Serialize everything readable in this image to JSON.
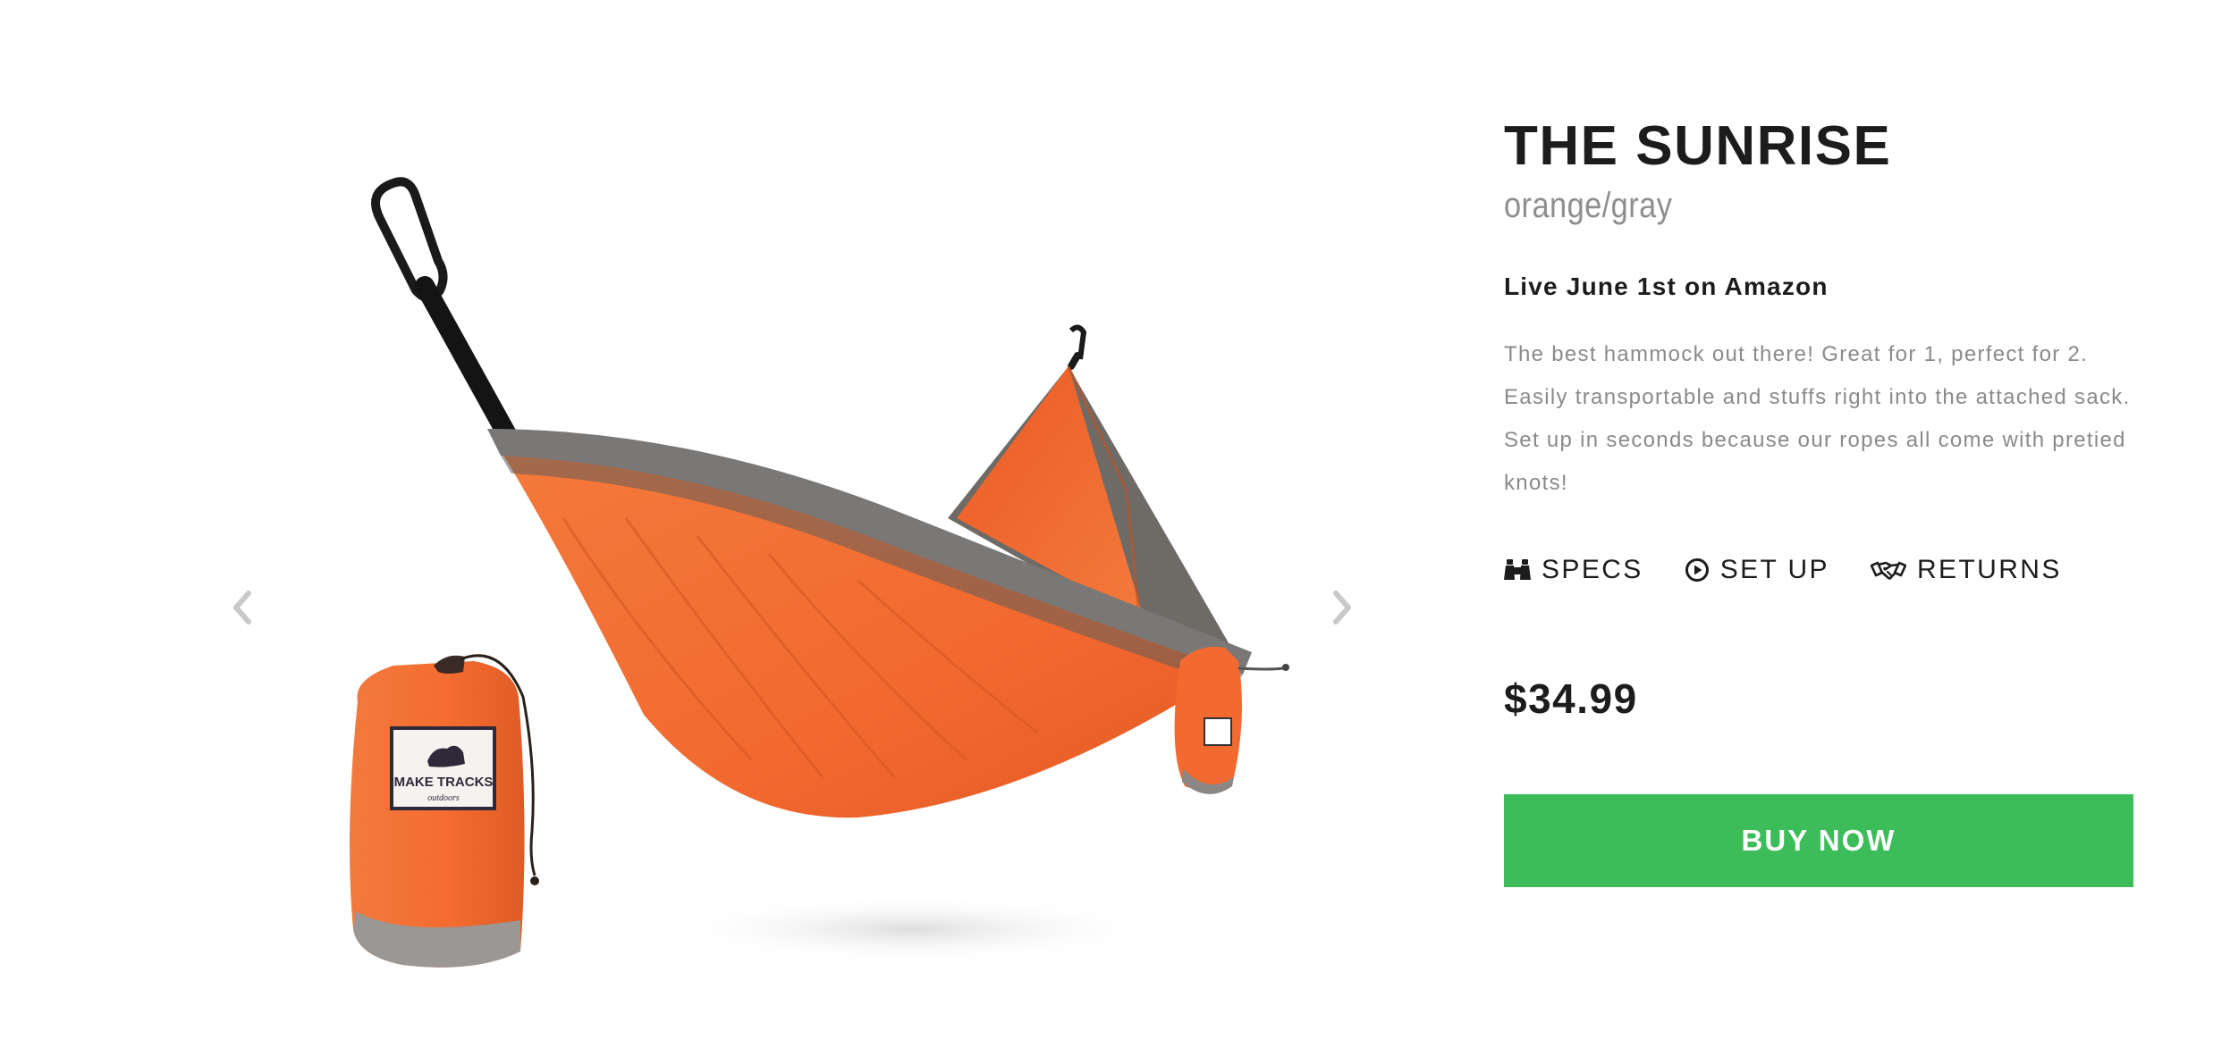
{
  "product": {
    "title": "THE SUNRISE",
    "color": "orange/gray",
    "availability": "Live June 1st on Amazon",
    "description": "The best hammock out there! Great for 1, perfect for 2. Easily transportable and stuffs right into the attached sack. Set up in seconds because our ropes all come with pretied knots!",
    "price": "$34.99",
    "buy_label": "BUY NOW"
  },
  "tabs": [
    {
      "label": "SPECS",
      "icon": "binoculars-icon"
    },
    {
      "label": "SET UP",
      "icon": "play-circle-icon"
    },
    {
      "label": "RETURNS",
      "icon": "handshake-icon"
    }
  ],
  "gallery": {
    "prev_icon": "chevron-left-icon",
    "next_icon": "chevron-right-icon",
    "image_subject": "orange and gray hammock with stuff sack",
    "sack_label": {
      "brand": "MAKE TRACKS",
      "sub": "outdoors"
    }
  },
  "colors": {
    "accent_green": "#3cbd5a",
    "hammock_orange": "#f26a30",
    "hammock_gray": "#7a7876",
    "text_dark": "#1c1c1c",
    "text_muted": "#8a8a8a"
  }
}
